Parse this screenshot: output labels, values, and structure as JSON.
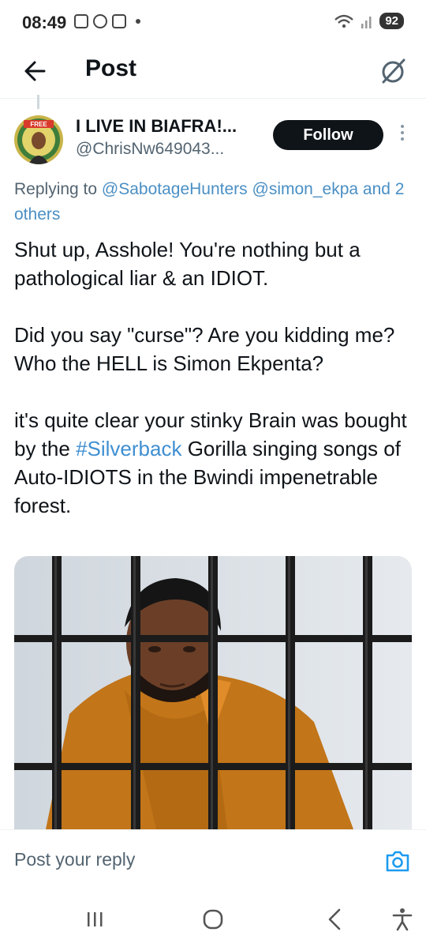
{
  "status_bar": {
    "time": "08:49",
    "battery": "92",
    "icons": [
      "square-icon",
      "whatsapp-icon",
      "screenshot-icon",
      "dot-icon",
      "wifi-icon",
      "signal-icon"
    ]
  },
  "header": {
    "title": "Post",
    "back_icon": "arrow-left-icon",
    "grok_icon": "grok-icon"
  },
  "tweet": {
    "author_name": "I LIVE IN BIAFRA!...",
    "author_handle": "@ChrisNw649043...",
    "follow_label": "Follow",
    "replying_prefix": "Replying to",
    "mention_1": "@SabotageHunters",
    "mention_2": "@simon_ekpa",
    "others": "and 2 others",
    "paragraph_1": "Shut up, Asshole! You're nothing but a pathological liar & an IDIOT.",
    "paragraph_2": "Did you say \"curse\"? Are you kidding me? Who the HELL is Simon Ekpenta?",
    "paragraph_3_before": "it's quite clear your stinky Brain was bought by the ",
    "hashtag": "#Silverback",
    "paragraph_3_after": " Gorilla singing songs of Auto-IDIOTS in the Bwindi impenetrable forest."
  },
  "reply_bar": {
    "placeholder": "Post your reply",
    "camera_icon": "camera-icon"
  },
  "nav_bar": {
    "recents_icon": "recents-icon",
    "home_icon": "home-icon",
    "back_icon": "back-chevron-icon",
    "accessibility_icon": "accessibility-icon"
  },
  "colors": {
    "link": "#1d9bf0",
    "follow_bg": "#0f1419",
    "prison_bars": "#1b1b1b",
    "jumpsuit": "#c77a1e"
  }
}
